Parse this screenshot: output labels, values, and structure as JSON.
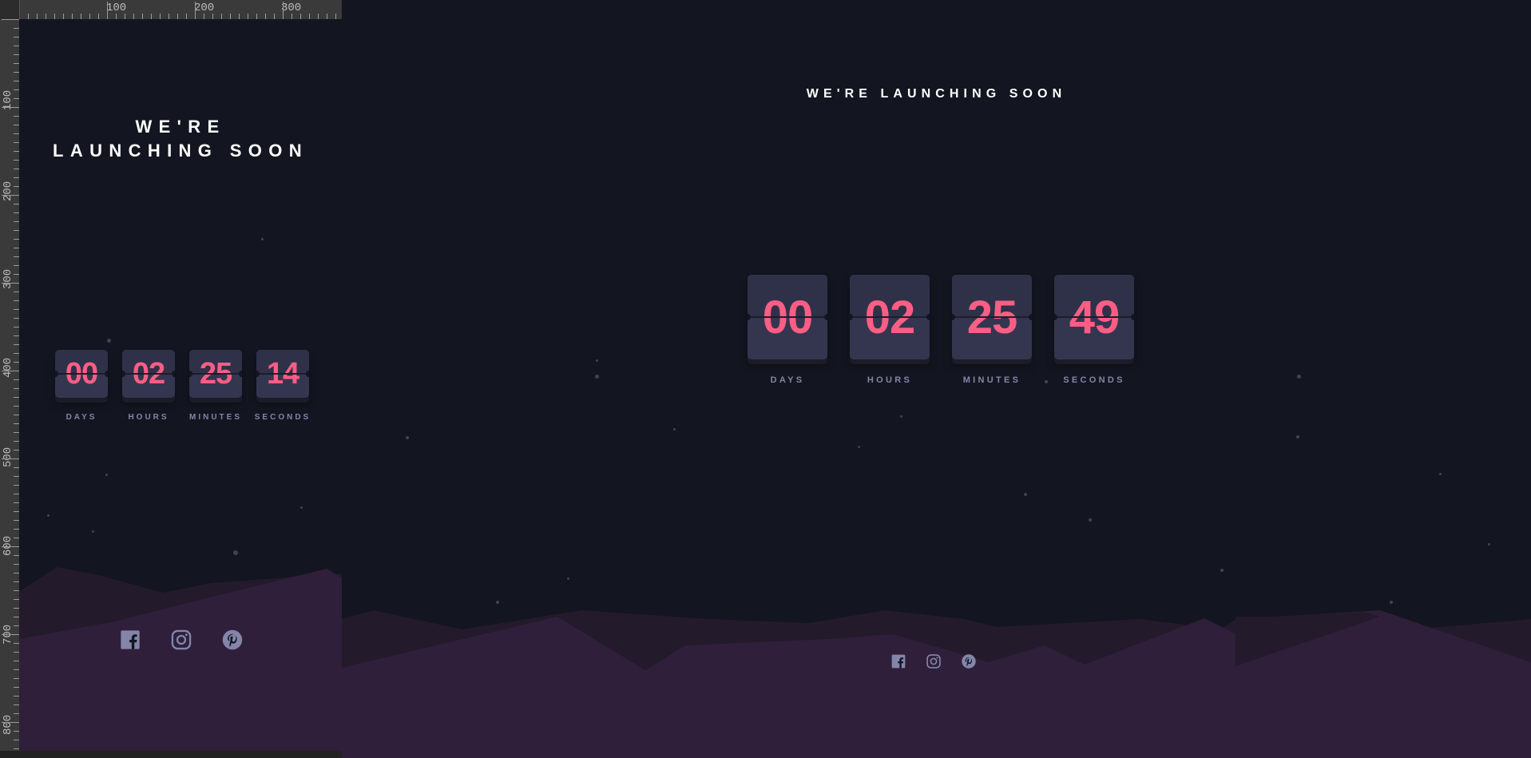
{
  "page": {
    "title": "WE'RE LAUNCHING SOON"
  },
  "ruler": {
    "top_labels": [
      "100",
      "200",
      "300"
    ],
    "left_labels": [
      "100",
      "200",
      "300",
      "400",
      "500",
      "600",
      "700",
      "800"
    ]
  },
  "countdown_mobile": {
    "days": "00",
    "hours": "02",
    "minutes": "25",
    "seconds": "14"
  },
  "countdown_desktop": {
    "days": "00",
    "hours": "02",
    "minutes": "25",
    "seconds": "49"
  },
  "labels": {
    "days": "DAYS",
    "hours": "HOURS",
    "minutes": "MINUTES",
    "seconds": "SECONDS"
  },
  "social": [
    "facebook-icon",
    "instagram-icon",
    "pinterest-icon"
  ],
  "colors": {
    "background": "#131520",
    "card": "#343650",
    "digits": "#fb5e84",
    "label": "#8385a9",
    "hills_back": "#231a2b",
    "hills_front": "#2f1f3a",
    "icons": "#8385a9"
  }
}
